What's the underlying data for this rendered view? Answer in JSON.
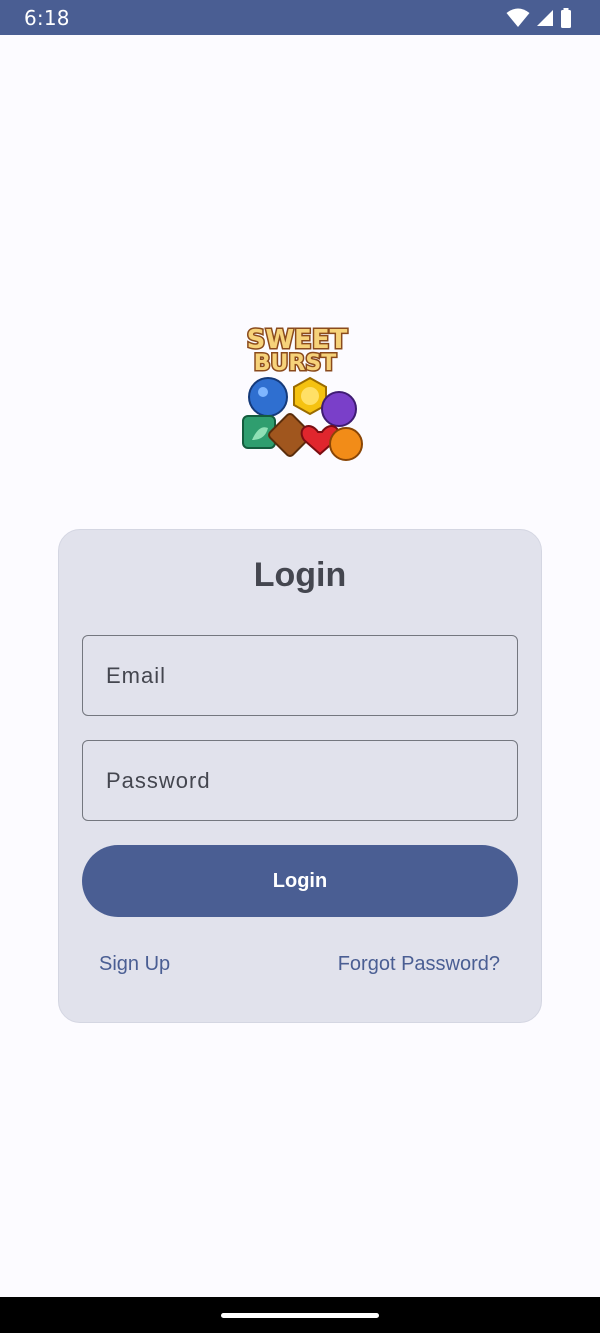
{
  "status_bar": {
    "time": "6:18",
    "icons": [
      "wifi-icon",
      "cellular-signal-icon",
      "battery-icon"
    ]
  },
  "logo": {
    "line1": "SWEET",
    "line2": "BURST"
  },
  "login_card": {
    "title": "Login",
    "email_placeholder": "Email",
    "password_placeholder": "Password",
    "login_button_label": "Login",
    "sign_up_label": "Sign Up",
    "forgot_password_label": "Forgot Password?"
  },
  "colors": {
    "primary": "#4a5e93",
    "background": "#fcfbff",
    "card_background": "#e1e2ec",
    "text": "#44464f"
  }
}
